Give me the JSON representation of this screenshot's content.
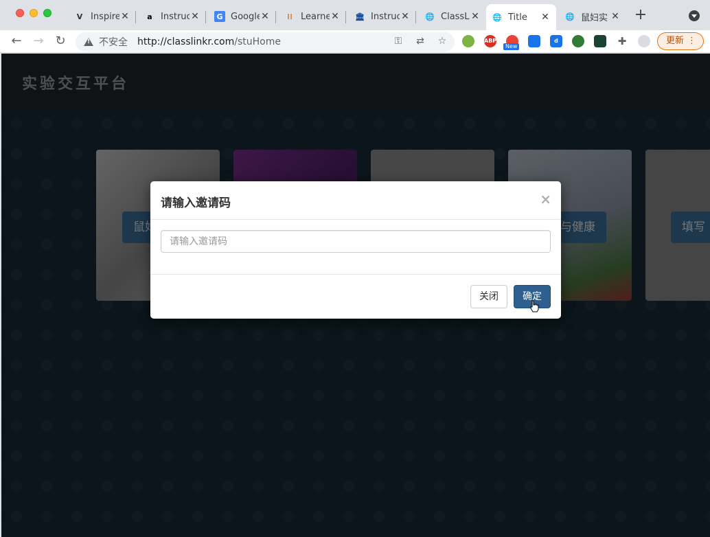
{
  "tabs": [
    {
      "label": "Inspire",
      "icon": "v-logo-icon"
    },
    {
      "label": "Instruc",
      "icon": "amazon-icon"
    },
    {
      "label": "Google",
      "icon": "google-translate-icon"
    },
    {
      "label": "Learne",
      "icon": "grid-icon"
    },
    {
      "label": "Instruc",
      "icon": "institution-icon"
    },
    {
      "label": "ClassL",
      "icon": "globe-icon"
    },
    {
      "label": "Title",
      "icon": "globe-icon"
    },
    {
      "label": "鼠妇实",
      "icon": "globe-icon"
    }
  ],
  "address_bar": {
    "security_label": "不安全",
    "url_host": "http://classlinkr.com",
    "url_path": "/stuHome"
  },
  "extensions": {
    "abp_label": "ABP",
    "new_badge": "New"
  },
  "update_button": "更新",
  "page": {
    "brand": "实验交互平台",
    "cards": [
      {
        "label": "鼠妇"
      },
      {
        "label": ""
      },
      {
        "label": ""
      },
      {
        "label": "与健康"
      },
      {
        "label": "填写"
      }
    ]
  },
  "modal": {
    "title": "请输入邀请码",
    "close_symbol": "×",
    "input_placeholder": "请输入邀请码",
    "input_value": "",
    "cancel_label": "关闭",
    "confirm_label": "确定"
  },
  "colors": {
    "accent": "#2e5f8e",
    "header_bg": "#222426",
    "page_bg": "#172b36"
  }
}
